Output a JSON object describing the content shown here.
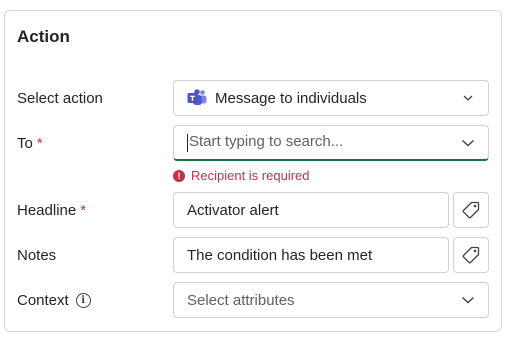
{
  "section": {
    "title": "Action"
  },
  "select_action": {
    "label": "Select action",
    "value": "Message to individuals",
    "icon": "teams-icon"
  },
  "to": {
    "label": "To",
    "required_marker": "*",
    "placeholder": "Start typing to search...",
    "error": "Recipient is required"
  },
  "headline": {
    "label": "Headline",
    "required_marker": "*",
    "value": "Activator alert"
  },
  "notes": {
    "label": "Notes",
    "value": "The condition has been met"
  },
  "context": {
    "label": "Context",
    "placeholder": "Select attributes"
  },
  "colors": {
    "required": "#c4314b",
    "focus_underline": "#1f6f4f",
    "teams_purple": "#5059c9"
  }
}
